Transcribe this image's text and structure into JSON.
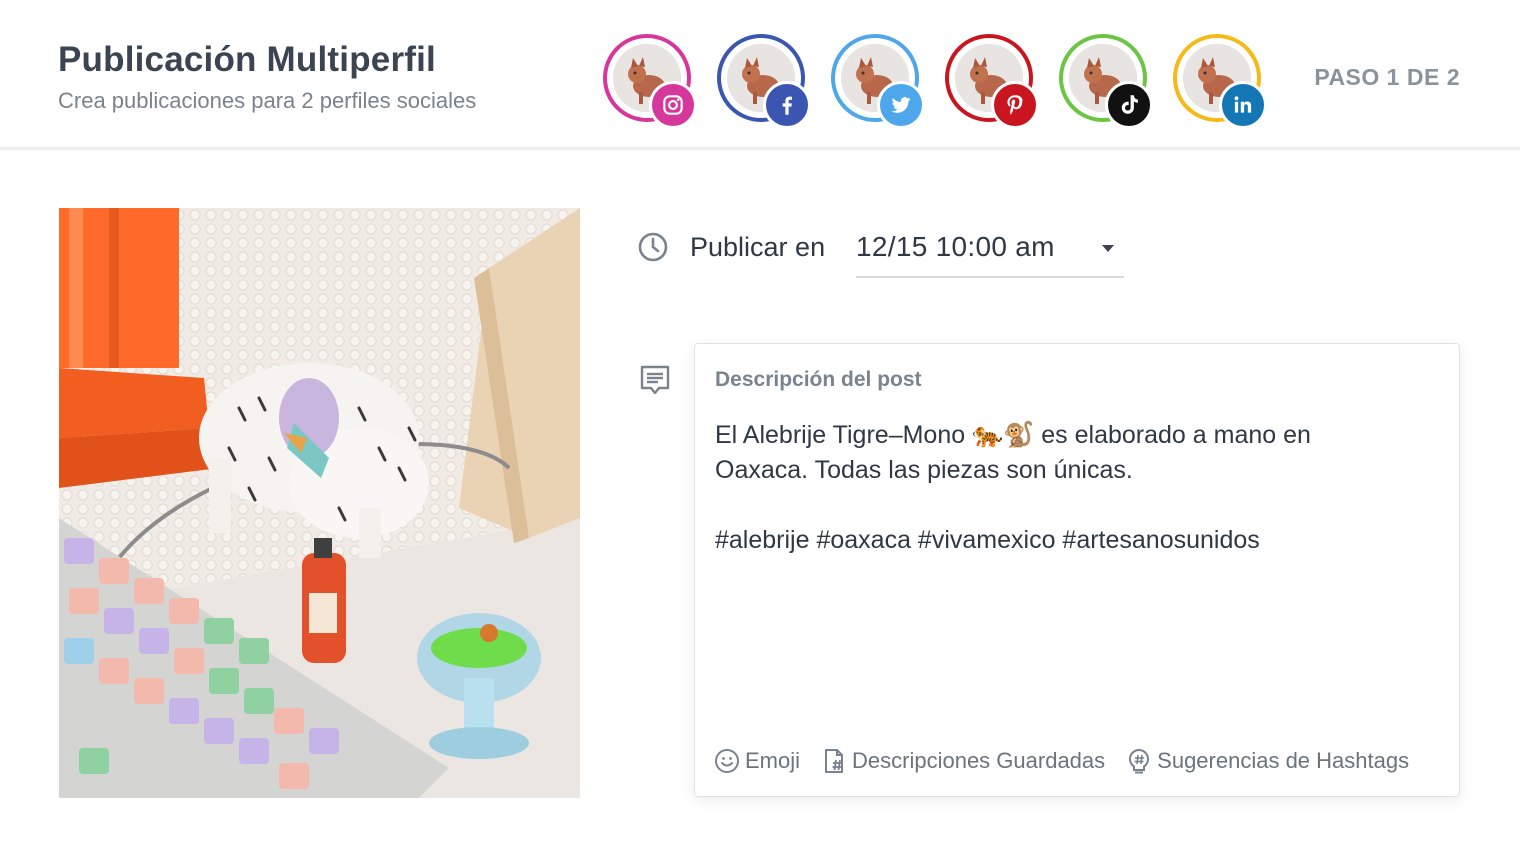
{
  "header": {
    "title": "Publicación Multiperfil",
    "subtitle": "Crea publicaciones para 2 perfiles sociales",
    "step": "PASO 1 DE 2"
  },
  "profiles": [
    {
      "network": "instagram",
      "ring_color": "#d6379b",
      "badge_color": "#d6379b",
      "icon": "instagram-icon"
    },
    {
      "network": "facebook",
      "ring_color": "#3b56b0",
      "badge_color": "#3b56b0",
      "icon": "facebook-icon"
    },
    {
      "network": "twitter",
      "ring_color": "#4ea7ea",
      "badge_color": "#4ea7ea",
      "icon": "twitter-icon"
    },
    {
      "network": "pinterest",
      "ring_color": "#c8151f",
      "badge_color": "#c8151f",
      "icon": "pinterest-icon"
    },
    {
      "network": "tiktok",
      "ring_color": "#6bc543",
      "badge_color": "#111111",
      "icon": "tiktok-icon"
    },
    {
      "network": "linkedin",
      "ring_color": "#f5b918",
      "badge_color": "#1377b5",
      "icon": "linkedin-icon"
    }
  ],
  "schedule": {
    "label": "Publicar en",
    "value": "12/15  10:00 am"
  },
  "description": {
    "label": "Descripción del post",
    "text": "El Alebrije Tigre–Mono 🐅🐒 es elaborado a mano en\nOaxaca. Todas las piezas son únicas.\n\n#alebrije #oaxaca #vivamexico #artesanosunidos"
  },
  "toolbar": {
    "emoji": "Emoji",
    "saved": "Descripciones Guardadas",
    "hashtags": "Sugerencias de Hashtags"
  },
  "colors": {
    "text_dark": "#3b4451",
    "text_muted": "#7a838d",
    "divider": "#eceef0"
  }
}
